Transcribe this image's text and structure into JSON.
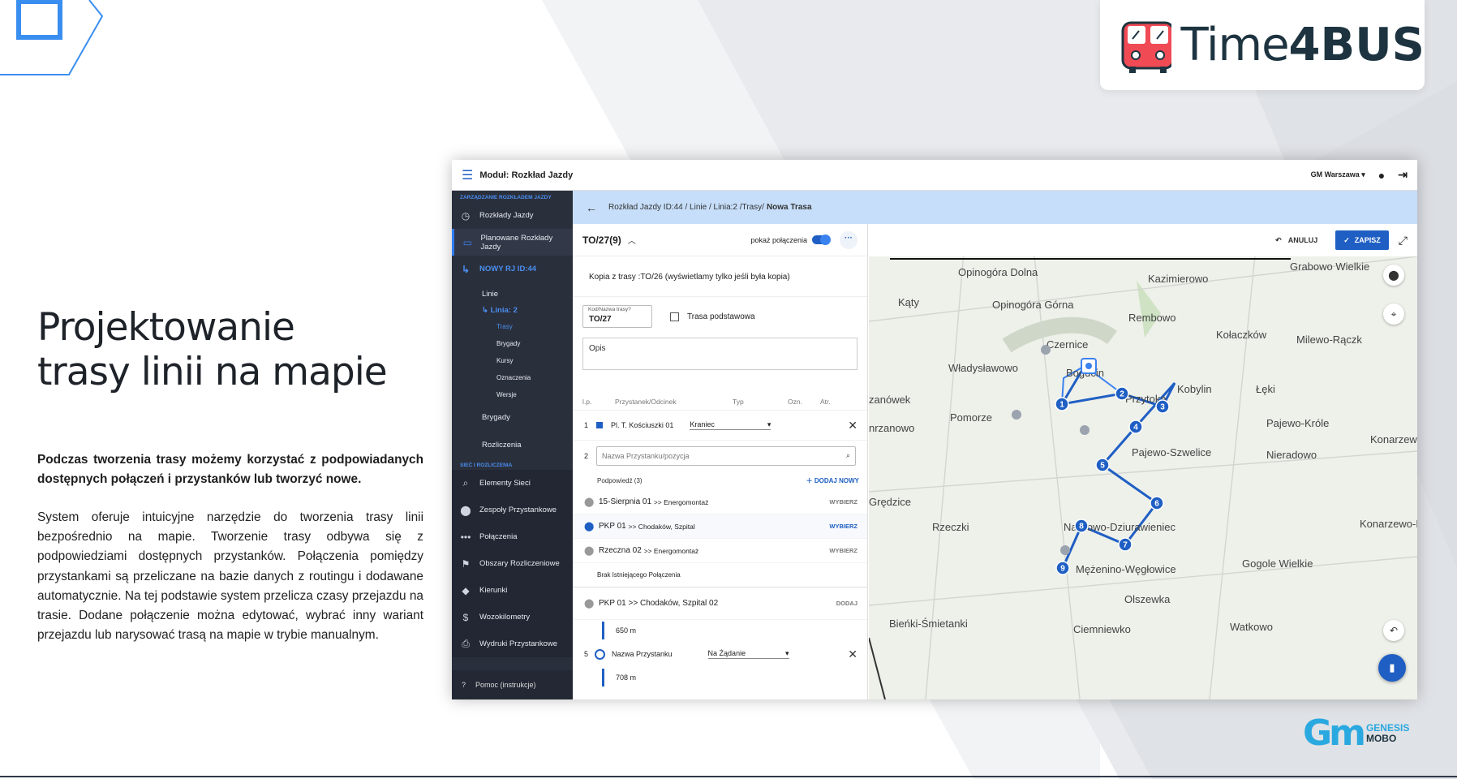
{
  "brand": {
    "logo_name": "Time",
    "logo_bold": "4BUS",
    "footer_gm": "Gm",
    "footer_genesis": "GENESIS",
    "footer_mobo": "MOBO"
  },
  "hero": {
    "line1": "Projektowanie",
    "line2": "trasy linii na mapie"
  },
  "lead": "Podczas tworzenia trasy możemy korzystać z podpowiadanych dostępnych połączeń i przystanków lub tworzyć nowe.",
  "body": "System oferuje intuicyjne narzędzie do tworzenia trasy linii bezpośrednio na mapie. Tworzenie trasy odbywa się z podpowiedziami dostępnych przystanków. Połączenia pomiędzy przystankami są przeliczane na bazie danych z routingu i dodawane automatycznie. Na tej podstawie system przelicza czasy przejazdu na trasie. Dodane połączenie można edytować, wybrać inny wariant przejazdu lub narysować trasą na mapie w trybie manualnym.",
  "app": {
    "module": "Moduł: Rozkład Jazdy",
    "user": "GM Warszawa",
    "breadcrumb": "Rozkład Jazdy ID:44 / Linie / Linia:2 /Trasy/",
    "breadcrumb_current": "Nowa Trasa",
    "sidebar": {
      "section1": "ZARZĄDZANIE ROZKŁADEM JAZDY",
      "rozklady": "Rozkłady Jazdy",
      "planowane": "Planowane Rozkłady Jazdy",
      "nowy": "NOWY RJ ID:44",
      "linie": "Linie",
      "linia2": "Linia: 2",
      "trasy": "Trasy",
      "brygady_sub": "Brygady",
      "kursy": "Kursy",
      "oznaczenia": "Oznaczenia",
      "wersje": "Wersje",
      "brygady": "Brygady",
      "rozliczenia": "Rozliczenia",
      "section2": "SIEĆ I ROZLICZENIA",
      "elementy": "Elementy Sieci",
      "zespoly": "Zespoły Przystankowe",
      "polaczenia": "Połączenia",
      "obszary": "Obszary Rozliczeniowe",
      "kierunki": "Kierunki",
      "wozokilometry": "Wozokilometry",
      "wydruki": "Wydruki Przystankowe",
      "pomoc": "Pomoc (instrukcje)"
    },
    "panel": {
      "route": "TO/27(9)",
      "show_conn": "pokaż połączenia",
      "copy_note": "Kopia z trasy :TO/26 (wyświetlamy tylko jeśli była kopia)",
      "code_label": "Kod/Nazwa trasy?",
      "code_value": "TO/27",
      "basic_route": "Trasa podstawowa",
      "opis": "Opis",
      "col_lp": "l.p.",
      "col_stop": "Przystanek/Odcinek",
      "col_type": "Typ",
      "col_ozn": "Ozn.",
      "col_atr": "Atr.",
      "row1_no": "1",
      "row1_stop": "Pl. T. Kościuszki 01",
      "row1_type": "Kraniec",
      "row2_no": "2",
      "search_placeholder": "Nazwa Przystanku/pozycja",
      "hints": "Podpowiedź (3)",
      "add_new": "DODAJ NOWY",
      "opt1": "15-Sierpnia 01",
      "opt1_dir": ">> Energomontaż",
      "opt2": "PKP 01",
      "opt2_dir": ">> Chodaków, Szpital",
      "opt3": "Rzeczna 02",
      "opt3_dir": ">> Energomontaż",
      "choose": "WYBIERZ",
      "no_conn": "Brak Istniejącego Połączenia",
      "opt4": "PKP 01 >> Chodaków, Szpital 02",
      "add": "DODAJ",
      "dist1": "650 m",
      "row5_no": "5",
      "row5_stop": "Nazwa Przystanku",
      "row5_type": "Na Żądanie",
      "dist2": "708 m"
    },
    "map": {
      "cancel": "ANULUJ",
      "save": "ZAPISZ",
      "places": [
        "Opinogóra Dolna",
        "Kazimierowo",
        "Grabowo Wielkie",
        "Kąty",
        "Opinogóra Górna",
        "Rembowo",
        "Czernice",
        "Kołaczków",
        "Milewo-Rączk",
        "Władysławowo",
        "Bogucin",
        "Kobylin",
        "Łęki",
        "zanówek",
        "Przytoka",
        "Pomorze",
        "Pajewo-Króle",
        "nrzanowo",
        "Pajewo-Szwelice",
        "Nieradowo",
        "Konarzew",
        "Grędzice",
        "Rzeczki",
        "Nasiłowo-Dziurawieniec",
        "Konarzewo-Marci",
        "Mężenino-Węgłowice",
        "Gogole Wielkie",
        "Olszewka",
        "Bieńki-Śmietanki",
        "Ciemniewko",
        "Watkowo"
      ],
      "stops": [
        "1",
        "2",
        "3",
        "4",
        "5",
        "6",
        "7",
        "8",
        "9"
      ]
    }
  }
}
